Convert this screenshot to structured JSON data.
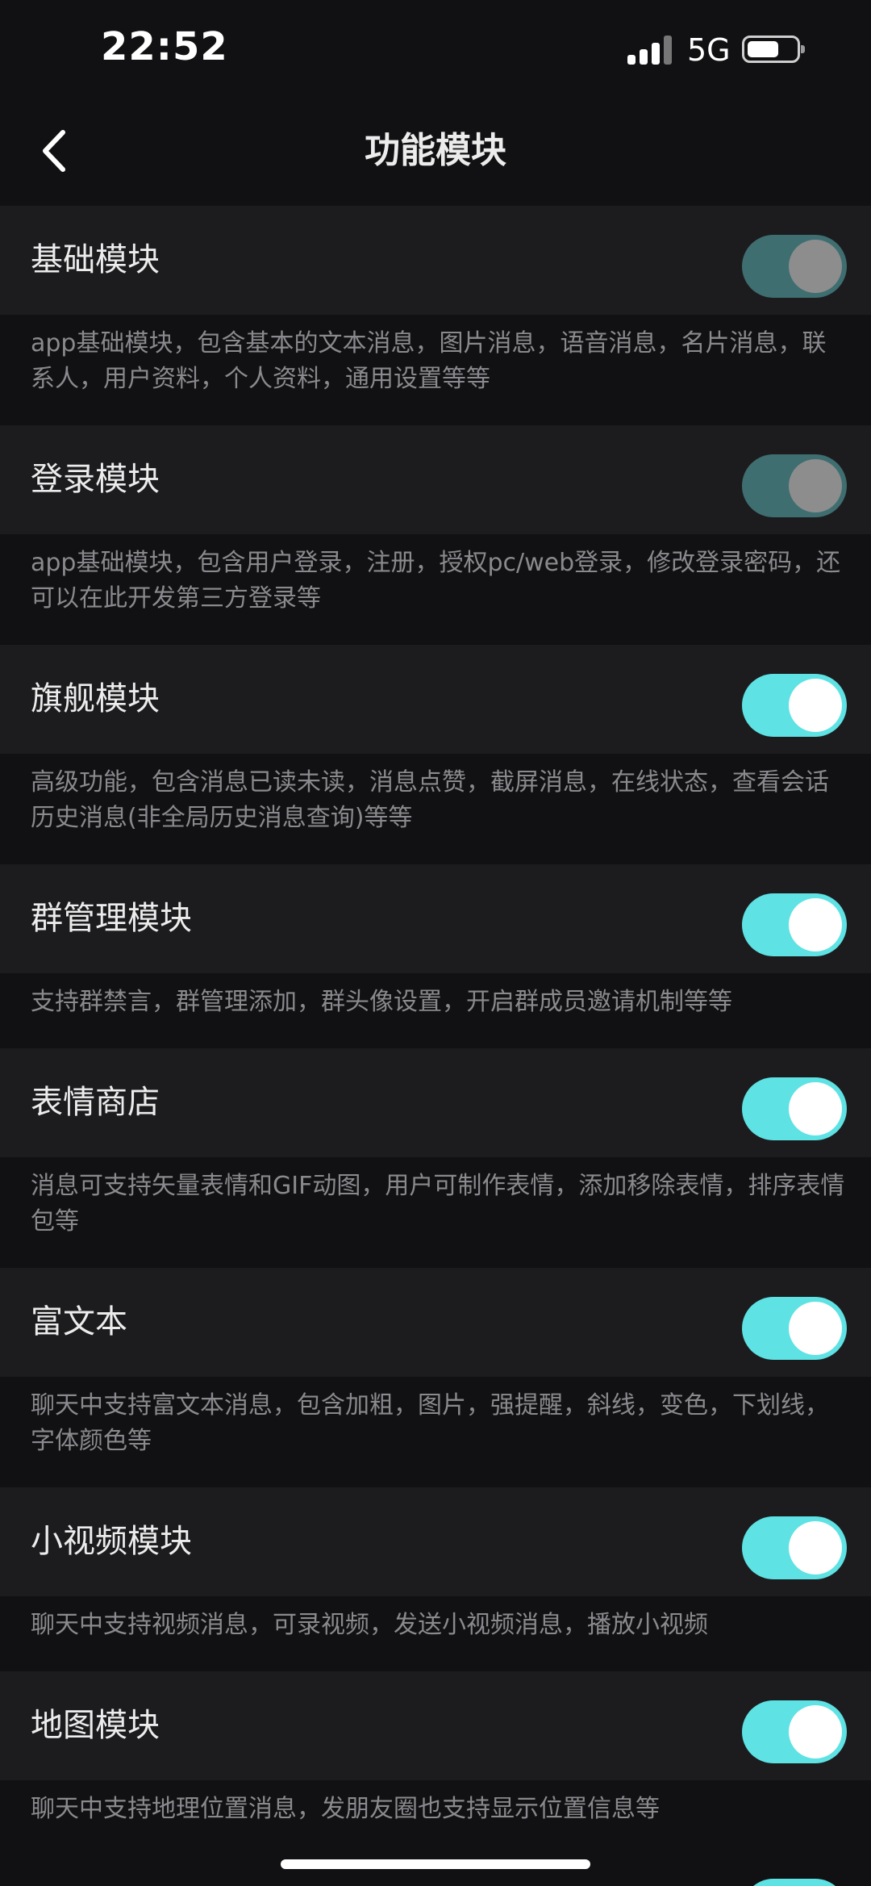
{
  "status_bar": {
    "time": "22:52",
    "network": "5G",
    "icons": [
      "signal-icon",
      "battery-icon"
    ]
  },
  "header": {
    "title": "功能模块",
    "back_icon": "chevron-left-icon"
  },
  "colors": {
    "background": "#111113",
    "row_background": "#1c1c1f",
    "toggle_on": "#5ee2e3",
    "toggle_disabled": "#3f6e70"
  },
  "modules": [
    {
      "title": "基础模块",
      "state": "on-disabled",
      "description": "app基础模块，包含基本的文本消息，图片消息，语音消息，名片消息，联系人，用户资料，个人资料，通用设置等等"
    },
    {
      "title": "登录模块",
      "state": "on-disabled",
      "description": "app基础模块，包含用户登录，注册，授权pc/web登录，修改登录密码，还可以在此开发第三方登录等"
    },
    {
      "title": "旗舰模块",
      "state": "on",
      "description": "高级功能，包含消息已读未读，消息点赞，截屏消息，在线状态，查看会话历史消息(非全局历史消息查询)等等"
    },
    {
      "title": "群管理模块",
      "state": "on",
      "description": "支持群禁言，群管理添加，群头像设置，开启群成员邀请机制等等"
    },
    {
      "title": "表情商店",
      "state": "on",
      "description": "消息可支持矢量表情和GIF动图，用户可制作表情，添加移除表情，排序表情包等"
    },
    {
      "title": "富文本",
      "state": "on",
      "description": "聊天中支持富文本消息，包含加粗，图片，强提醒，斜线，变色，下划线，字体颜色等"
    },
    {
      "title": "小视频模块",
      "state": "on",
      "description": "聊天中支持视频消息，可录视频，发送小视频消息，播放小视频"
    },
    {
      "title": "地图模块",
      "state": "on",
      "description": "聊天中支持地理位置消息，发朋友圈也支持显示位置信息等"
    }
  ]
}
